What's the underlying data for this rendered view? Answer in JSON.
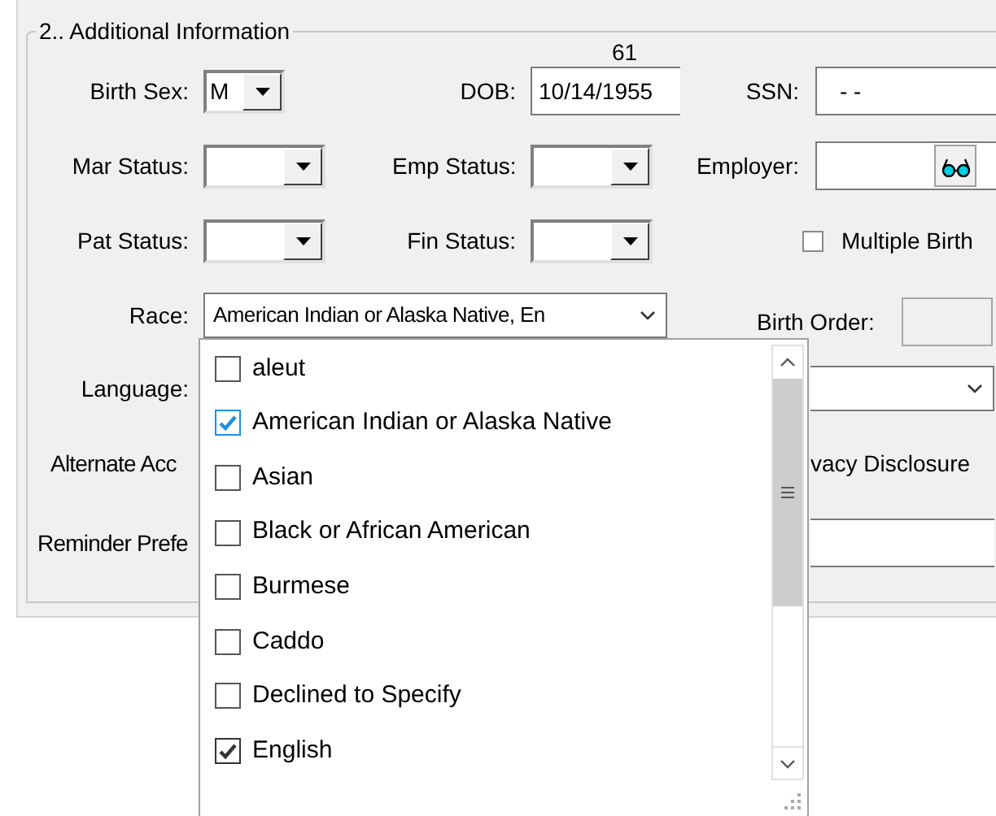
{
  "group": {
    "title": "2.. Additional Information"
  },
  "age": "61",
  "rows": [
    [
      {
        "kind": "combo",
        "label": "Birth Sex:",
        "value": "M"
      },
      {
        "kind": "text",
        "label": "DOB:",
        "value": "10/14/1955"
      },
      {
        "kind": "text",
        "label": "SSN:",
        "value": "- -"
      }
    ],
    [
      {
        "kind": "combo",
        "label": "Mar Status:"
      },
      {
        "kind": "combo",
        "label": "Emp Status:"
      },
      {
        "kind": "lookup",
        "label": "Employer:"
      }
    ],
    [
      {
        "kind": "combo",
        "label": "Pat Status:"
      },
      {
        "kind": "combo",
        "label": "Fin Status:"
      },
      {
        "kind": "checkbox",
        "label": "Multiple Birth",
        "checked": false
      }
    ]
  ],
  "race": {
    "label": "Race:",
    "value": "American Indian or Alaska Native, En"
  },
  "birth_order": {
    "label": "Birth Order:"
  },
  "language": {
    "label": "Language:"
  },
  "alternate_acc": {
    "label": "Alternate Acc"
  },
  "privacy_disclosure": {
    "label": "vacy Disclosure"
  },
  "reminder_pref": {
    "label": "Reminder Prefe"
  },
  "race_list": [
    {
      "label": "aleut",
      "checked": false,
      "color": "#555555"
    },
    {
      "label": "American Indian or Alaska Native",
      "checked": true,
      "color": "#1e90e0"
    },
    {
      "label": "Asian",
      "checked": false,
      "color": "#555555"
    },
    {
      "label": "Black or African American",
      "checked": false,
      "color": "#555555"
    },
    {
      "label": "Burmese",
      "checked": false,
      "color": "#555555"
    },
    {
      "label": "Caddo",
      "checked": false,
      "color": "#555555"
    },
    {
      "label": "Declined to Specify",
      "checked": false,
      "color": "#555555"
    },
    {
      "label": "English",
      "checked": true,
      "color": "#333333"
    }
  ]
}
